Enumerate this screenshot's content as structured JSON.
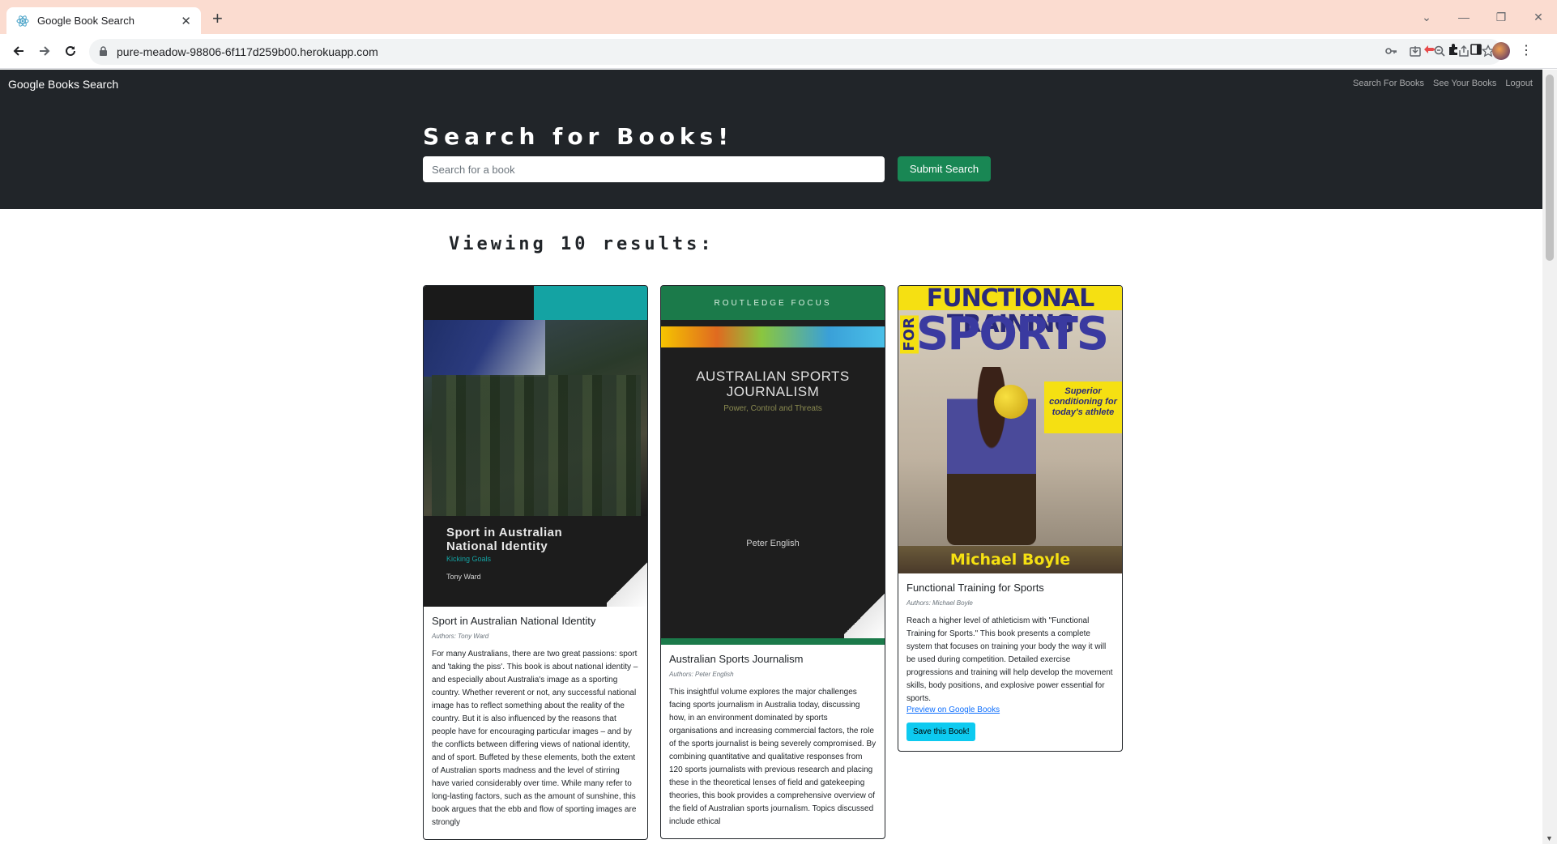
{
  "browser": {
    "tab_title": "Google Book Search",
    "url": "pure-meadow-98806-6f117d259b00.herokuapp.com"
  },
  "navbar": {
    "brand": "Google Books Search",
    "links": [
      "Search For Books",
      "See Your Books",
      "Logout"
    ]
  },
  "hero": {
    "title": "Search for Books!",
    "search_placeholder": "Search for a book",
    "submit_label": "Submit Search"
  },
  "results": {
    "heading": "Viewing 10 results:",
    "books": [
      {
        "title": "Sport in Australian National Identity",
        "authors": "Authors: Tony Ward",
        "description": "For many Australians, there are two great passions: sport and 'taking the piss'. This book is about national identity – and especially about Australia's image as a sporting country. Whether reverent or not, any successful national image has to reflect something about the reality of the country. But it is also influenced by the reasons that people have for encouraging particular images – and by the conflicts between differing views of national identity, and of sport. Buffeted by these elements, both the extent of Australian sports madness and the level of stirring have varied considerably over time. While many refer to long-lasting factors, such as the amount of sunshine, this book argues that the ebb and flow of sporting images are strongly",
        "cover": {
          "title_line1": "Sport in Australian",
          "title_line2": "National Identity",
          "subtitle": "Kicking Goals",
          "author": "Tony Ward"
        }
      },
      {
        "title": "Australian Sports Journalism",
        "authors": "Authors: Peter English",
        "description": "This insightful volume explores the major challenges facing sports journalism in Australia today, discussing how, in an environment dominated by sports organisations and increasing commercial factors, the role of the sports journalist is being severely compromised. By combining quantitative and qualitative responses from 120 sports journalists with previous research and placing these in the theoretical lenses of field and gatekeeping theories, this book provides a comprehensive overview of the field of Australian sports journalism. Topics discussed include ethical",
        "cover": {
          "series": "ROUTLEDGE FOCUS",
          "title_line1": "AUSTRALIAN SPORTS",
          "title_line2": "JOURNALISM",
          "subtitle": "Power, Control and Threats",
          "author": "Peter English"
        }
      },
      {
        "title": "Functional Training for Sports",
        "authors": "Authors: Michael Boyle",
        "description": "Reach a higher level of athleticism with \"Functional Training for Sports.\" This book presents a complete system that focuses on training your body the way it will be used during competition. Detailed exercise progressions and training will help develop the movement skills, body positions, and explosive power essential for sports.",
        "link": "Preview on Google Books",
        "save_label": "Save this Book!",
        "cover": {
          "title_line1": "FUNCTIONAL TRAINING",
          "for_text": "FOR",
          "title_line2": "SPORTS",
          "tagline": "Superior conditioning for today's athlete",
          "author": "Michael Boyle"
        }
      }
    ]
  }
}
